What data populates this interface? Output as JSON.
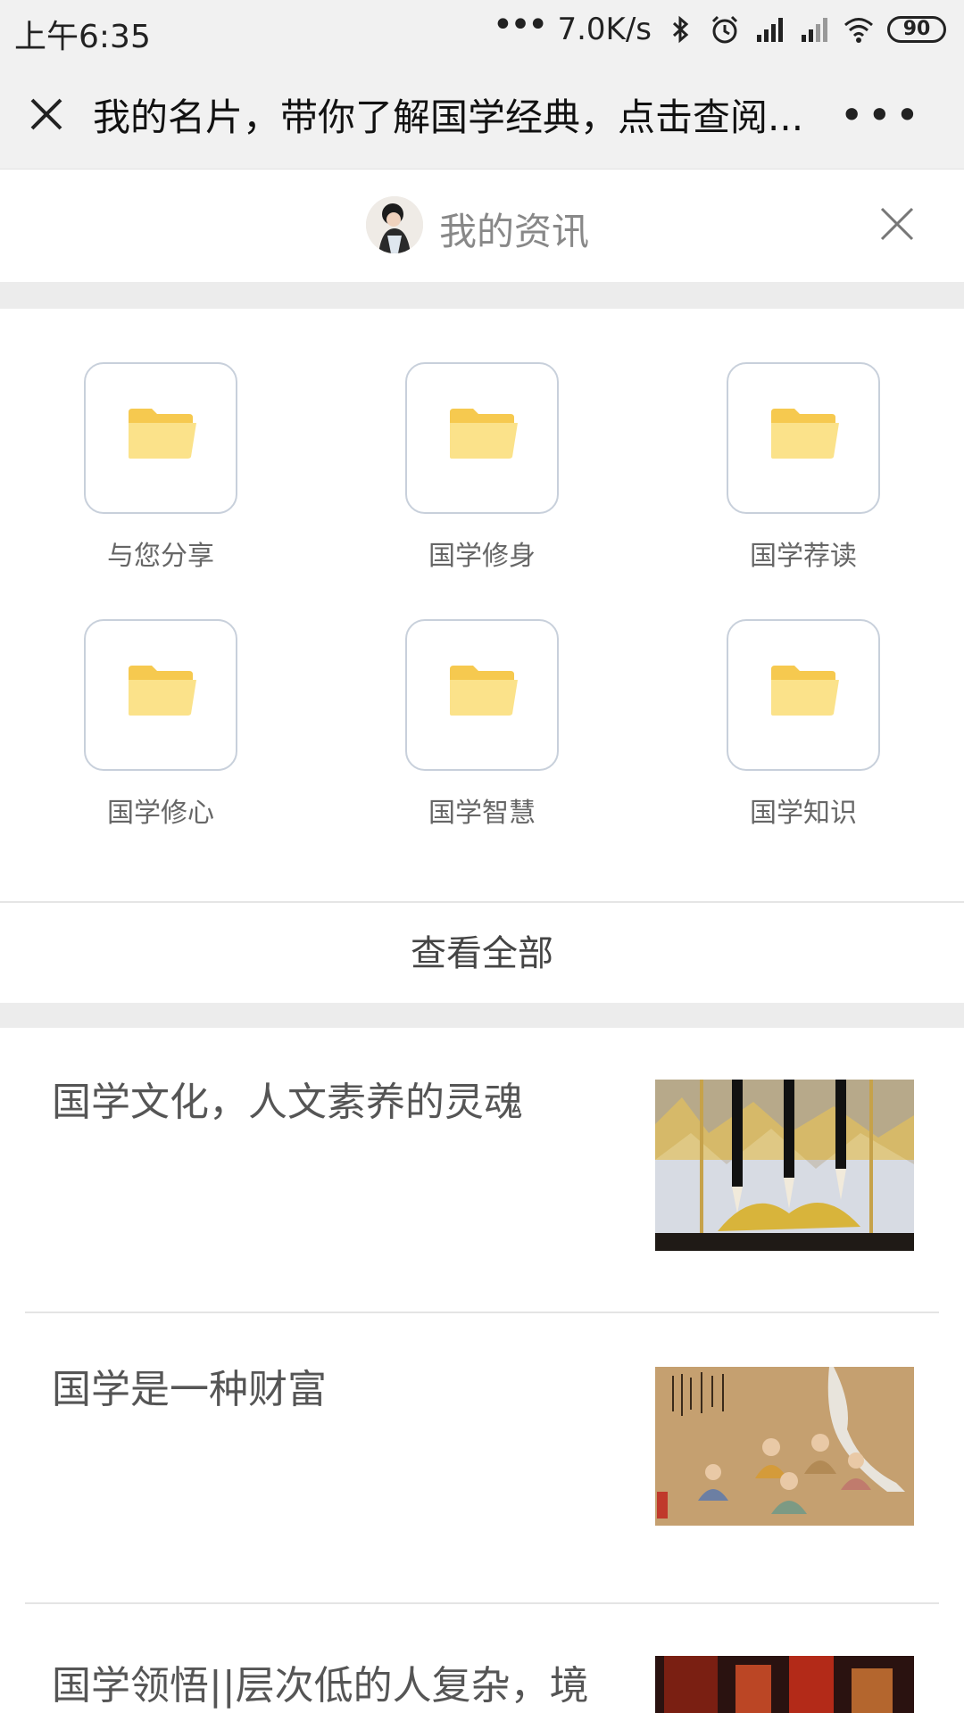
{
  "status_bar": {
    "time": "上午6:35",
    "network_speed": "7.0K/s",
    "battery": "90",
    "icons": [
      "more-dots-icon",
      "bluetooth-icon",
      "alarm-icon",
      "hd-signal-icon",
      "signal-icon",
      "wifi-icon",
      "battery-icon"
    ]
  },
  "nav": {
    "title": "我的名片，带你了解国学经典，点击查阅...",
    "close_icon": "close-icon",
    "more_icon": "more-icon"
  },
  "profile": {
    "title": "我的资讯",
    "close_icon": "close-icon"
  },
  "folders": [
    {
      "label": "与您分享"
    },
    {
      "label": "国学修身"
    },
    {
      "label": "国学荐读"
    },
    {
      "label": "国学修心"
    },
    {
      "label": "国学智慧"
    },
    {
      "label": "国学知识"
    }
  ],
  "view_all_label": "查看全部",
  "articles": [
    {
      "title": "国学文化，人文素养的灵魂",
      "thumb": "calligraphy-brushes-image"
    },
    {
      "title": "国学是一种财富",
      "thumb": "scholars-painting-image"
    },
    {
      "title": "国学领悟||层次低的人复杂，境界",
      "thumb": "red-lanterns-image"
    }
  ],
  "colors": {
    "folder_yellow": "#fbd86a",
    "folder_border": "#c8d0db",
    "bar_gray": "#f1f1f1"
  }
}
